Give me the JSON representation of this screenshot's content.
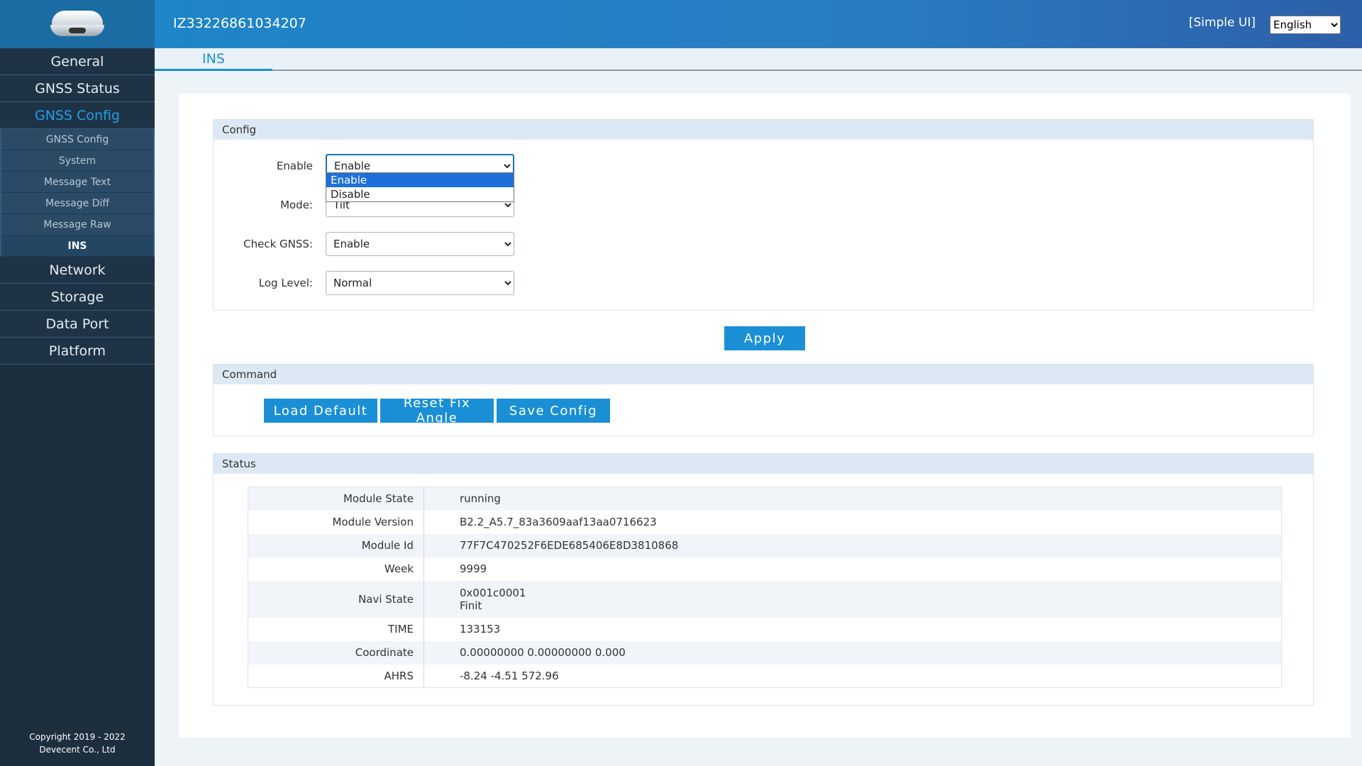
{
  "header": {
    "device_id": "IZ33226861034207",
    "simple_ui": "[Simple UI]",
    "language": "English",
    "language_options": [
      "English"
    ]
  },
  "sidebar": {
    "items": [
      {
        "label": "General"
      },
      {
        "label": "GNSS Status"
      },
      {
        "label": "GNSS Config"
      },
      {
        "label": "Network"
      },
      {
        "label": "Storage"
      },
      {
        "label": "Data Port"
      },
      {
        "label": "Platform"
      }
    ],
    "sub_items": [
      {
        "label": "GNSS Config"
      },
      {
        "label": "System"
      },
      {
        "label": "Message Text"
      },
      {
        "label": "Message Diff"
      },
      {
        "label": "Message Raw"
      },
      {
        "label": "INS"
      }
    ],
    "copyright_line1": "Copyright 2019 - 2022",
    "copyright_line2": "Devecent Co., Ltd"
  },
  "tab": {
    "label": "INS"
  },
  "config": {
    "title": "Config",
    "enable_label": "Enable",
    "enable_value": "Enable",
    "enable_options": [
      "Enable",
      "Disable"
    ],
    "mode_label": "Mode:",
    "mode_value": "Tilt",
    "check_gnss_label": "Check GNSS:",
    "check_gnss_value": "Enable",
    "log_level_label": "Log Level:",
    "log_level_value": "Normal",
    "apply_label": "Apply"
  },
  "command": {
    "title": "Command",
    "load_default": "Load Default",
    "reset_fix_angle": "Reset Fix Angle",
    "save_config": "Save Config"
  },
  "status": {
    "title": "Status",
    "rows": [
      {
        "key": "Module State",
        "value": "running"
      },
      {
        "key": "Module Version",
        "value": "B2.2_A5.7_83a3609aaf13aa0716623"
      },
      {
        "key": "Module Id",
        "value": "77F7C470252F6EDE685406E8D3810868"
      },
      {
        "key": "Week",
        "value": "9999"
      },
      {
        "key": "Navi State",
        "value": "0x001c0001",
        "value2": "Finit"
      },
      {
        "key": "TIME",
        "value": "133153"
      },
      {
        "key": "Coordinate",
        "value": "0.00000000 0.00000000 0.000"
      },
      {
        "key": "AHRS",
        "value": "-8.24 -4.51 572.96"
      }
    ]
  }
}
